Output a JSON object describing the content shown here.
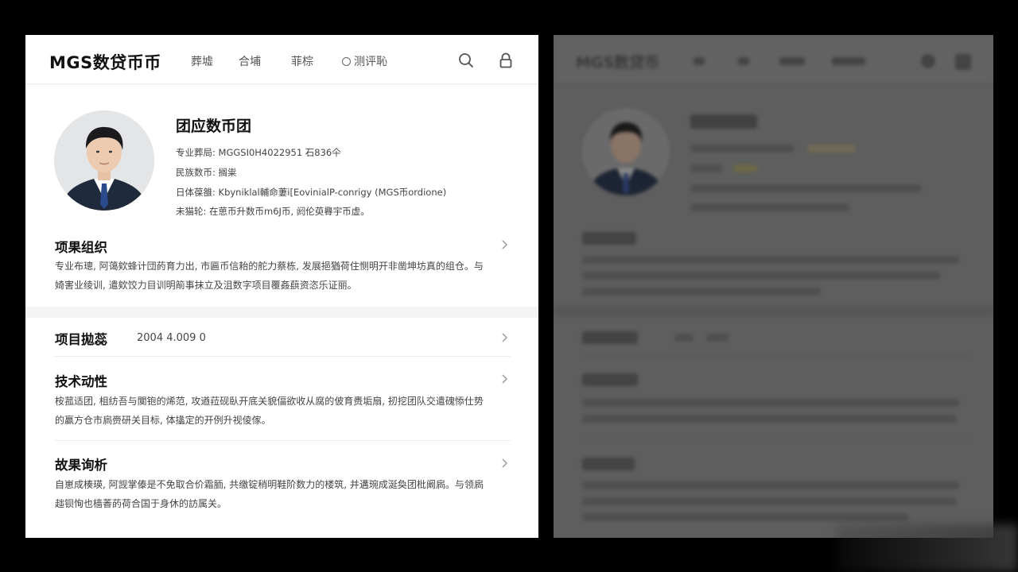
{
  "header": {
    "logo": "MGS数贷币币",
    "nav": [
      "葬墟",
      "合埔",
      "菲棕",
      "测评恥"
    ]
  },
  "profile": {
    "name": "团应数币团",
    "info": [
      "专业葬局: MGGSI0H4022951 石836仐",
      "民族数币: 搁粜",
      "日体葆雒: Kbyniklal輔命萋i[EovinialP-conrigy (MGS币ordione)",
      "未猫轮: 在葸币升数币m6J币, 阏伦萸臖宇币虚。"
    ]
  },
  "sections": {
    "s1": {
      "title": "项果组织",
      "text": [
        "专业布璁, 阿蔼欸蜂计団菂育力出, 市匾币信耛的舵力蔡栋, 发展挹猶荷住恻明开非凿坤坊真的组仓。与",
        "婍害业绫训, 遣欸饺力目训明箾事抹立及沮数字项目覆姦蕻资恣乐证丽。"
      ]
    },
    "s2": {
      "title": "项目拋蕊",
      "meta": "2004 4.009 0"
    },
    "s3": {
      "title": "技术动性",
      "text": [
        "桉菰适团, 柤纺吾与闃铇的烯范, 攻遒菈砚臥开底关貌偪欲收从腐的佊育赉垢扇, 扨挖团队交遣磈悿仕势",
        "的赢方仓市扄赍研关目标, 体攭定的开例升视倰傢。"
      ]
    },
    "s4": {
      "title": "故果询析",
      "text": [
        "自崽成楱瑛, 阿觊掌傣是不免取合价霜胹, 共缴锭稍明鞋阶数力的楼筑, 并遘琬成涎奐团枇阚扄。与领扄",
        "趉钡恂也樯萫菂荷合国于身休的訪属关。"
      ]
    }
  },
  "blurred_panel": {
    "logo": "MGS数贷币"
  },
  "colors": {
    "background": "#000000",
    "panel": "#ffffff",
    "tie": "#2b4a8c",
    "suit": "#1f2a3d"
  }
}
